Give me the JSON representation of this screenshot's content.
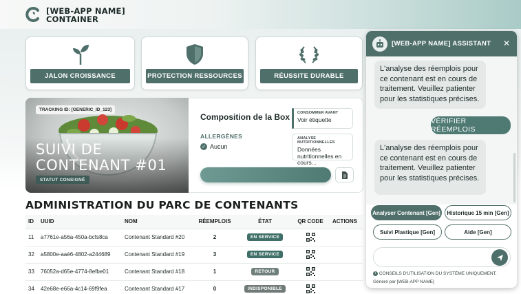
{
  "app": {
    "name_line1": "[WEB-APP NAME]",
    "name_line2": "CONTAINER"
  },
  "badges": [
    {
      "icon": "sprout-icon",
      "label": "JALON CROISSANCE"
    },
    {
      "icon": "shield-icon",
      "label": "PROTECTION RESSOURCES"
    },
    {
      "icon": "laurel-wreath-icon",
      "label": "RÉUSSITE DURABLE"
    }
  ],
  "hero": {
    "tracking": "TRACKING ID: [GENERIC_ID_123]",
    "title": "SUIVI DE CONTENANT #01",
    "status": "STATUT CONSIGNÉ"
  },
  "box": {
    "title": "Composition de la Box",
    "allergens_label": "ALLERGÈNES",
    "allergens_value": "Aucun",
    "consume_label": "CONSOMMER AVANT",
    "consume_value": "Voir étiquette",
    "nutrition_label": "ANALYSE NUTRITIONNELLES",
    "nutrition_value": "Données nutritionnelles en cours..."
  },
  "fleet": {
    "title": "ADMINISTRATION DU PARC DE CONTENANTS",
    "columns": [
      "ID",
      "UUID",
      "NOM",
      "RÉEMPLOIS",
      "ÉTAT",
      "QR CODE",
      "ACTIONS"
    ],
    "rows": [
      {
        "id": "11",
        "uuid": "a7761e-a56a-450a-bcfs8ca",
        "nom": "Contenant Standard #20",
        "reemplois": "2",
        "etat": "EN SERVICE",
        "etat_color": "#3f6f68"
      },
      {
        "id": "32",
        "uuid": "a5800e-aaé6-4802-a244689",
        "nom": "Contenant Standard #19",
        "reemplois": "3",
        "etat": "EN SERVICE",
        "etat_color": "#3f6f68"
      },
      {
        "id": "33",
        "uuid": "76052a-d65e-4774-8efbe01",
        "nom": "Contenant Standard #18",
        "reemplois": "1",
        "etat": "RETOUR",
        "etat_color": "#6f7f7c"
      },
      {
        "id": "34",
        "uuid": "42e68e-e66a-4c14-69f9fea",
        "nom": "Contenant Standard #17",
        "reemplois": "0",
        "etat": "INDISPONIBLE",
        "etat_color": "#707a78"
      }
    ]
  },
  "assistant": {
    "title": "[WEB-APP NAME] ASSISTANT",
    "messages": [
      {
        "role": "bot",
        "text": "L'analyse des réemplois pour ce contenant est en cours de traitement. Veuillez patienter pour les statistiques précises."
      },
      {
        "role": "user",
        "text": "VÉRIFIER RÉEMPLOIS"
      },
      {
        "role": "bot",
        "text": "L'analyse des réemplois pour ce contenant est en cours de traitement. Veuillez patienter pour les statistiques précises."
      }
    ],
    "chips": [
      "Analyser Contenant [Gen]",
      "Historique 15 min [Gen]",
      "Suivi Plastique [Gen]",
      "Aide [Gen]"
    ],
    "input_placeholder": "",
    "disclaimer_line1": "CONSEILS D'UTILISATION DU SYSTÈME UNIQUEMENT.",
    "disclaimer_line2": "Généré par [WEB-APP NAME]"
  },
  "colors": {
    "accent": "#4f6f6a",
    "accent_light": "#4f7a73"
  }
}
